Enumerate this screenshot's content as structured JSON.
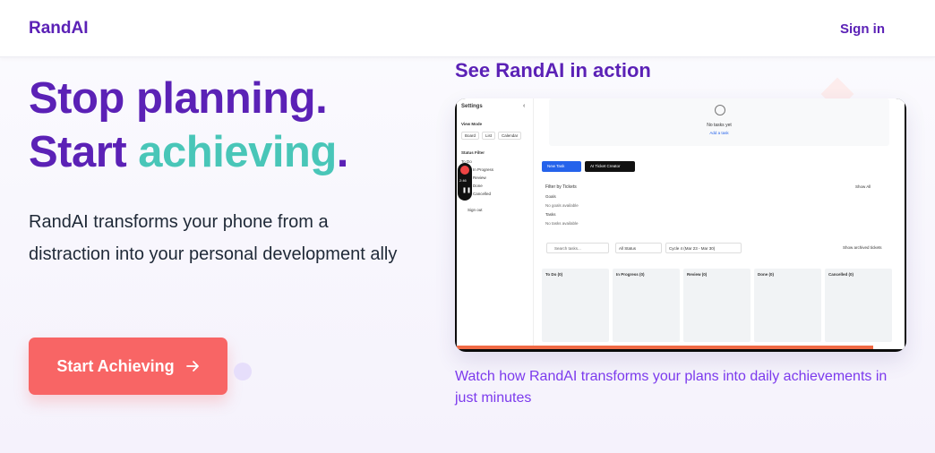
{
  "nav": {
    "logo": "RandAI",
    "sign_in": "Sign in"
  },
  "hero": {
    "line1": "Stop planning.",
    "line2_prefix": "Start",
    "line2_accent": "achieving",
    "line2_suffix": ".",
    "description": "RandAI transforms your phone from a distraction into your personal development ally",
    "cta_label": "Start Achieving"
  },
  "video": {
    "heading": "See RandAI in action",
    "caption": "Watch how RandAI transforms your plans into daily achievements in just minutes",
    "progress": 0.93,
    "app": {
      "settings_title": "Settings",
      "view_mode_label": "View Mode",
      "view_tabs": [
        "Board",
        "List",
        "Calendar"
      ],
      "status_filter_label": "Status Filter",
      "status_items": [
        "To Do",
        "In Progress",
        "Review",
        "Done",
        "Cancelled"
      ],
      "sign_out": "Sign out",
      "recording_time": "2:46",
      "no_tasks": "No tasks yet",
      "add_task": "Add a task",
      "new_task_button": "New Task",
      "ai_ticket_button": "AI Ticket Creator",
      "filter_by_tickets": "Filter by Tickets",
      "show_all": "Show All",
      "goals_label": "Goals",
      "no_goals": "No goals available",
      "tasks_label": "Tasks",
      "no_tasks_available": "No tasks available",
      "search_placeholder": "Search tasks...",
      "status_select": "All Status",
      "cycle_select": "Cycle 4 (Mar 23 - Mar 30)",
      "show_archived": "Show archived tickets",
      "columns": [
        "To Do (0)",
        "In Progress (0)",
        "Review (0)",
        "Done (0)",
        "Cancelled (0)"
      ]
    }
  },
  "colors": {
    "brand": "#5b21b6",
    "accent": "#49c6b8",
    "cta": "#f86565",
    "caption": "#7c3aed"
  }
}
